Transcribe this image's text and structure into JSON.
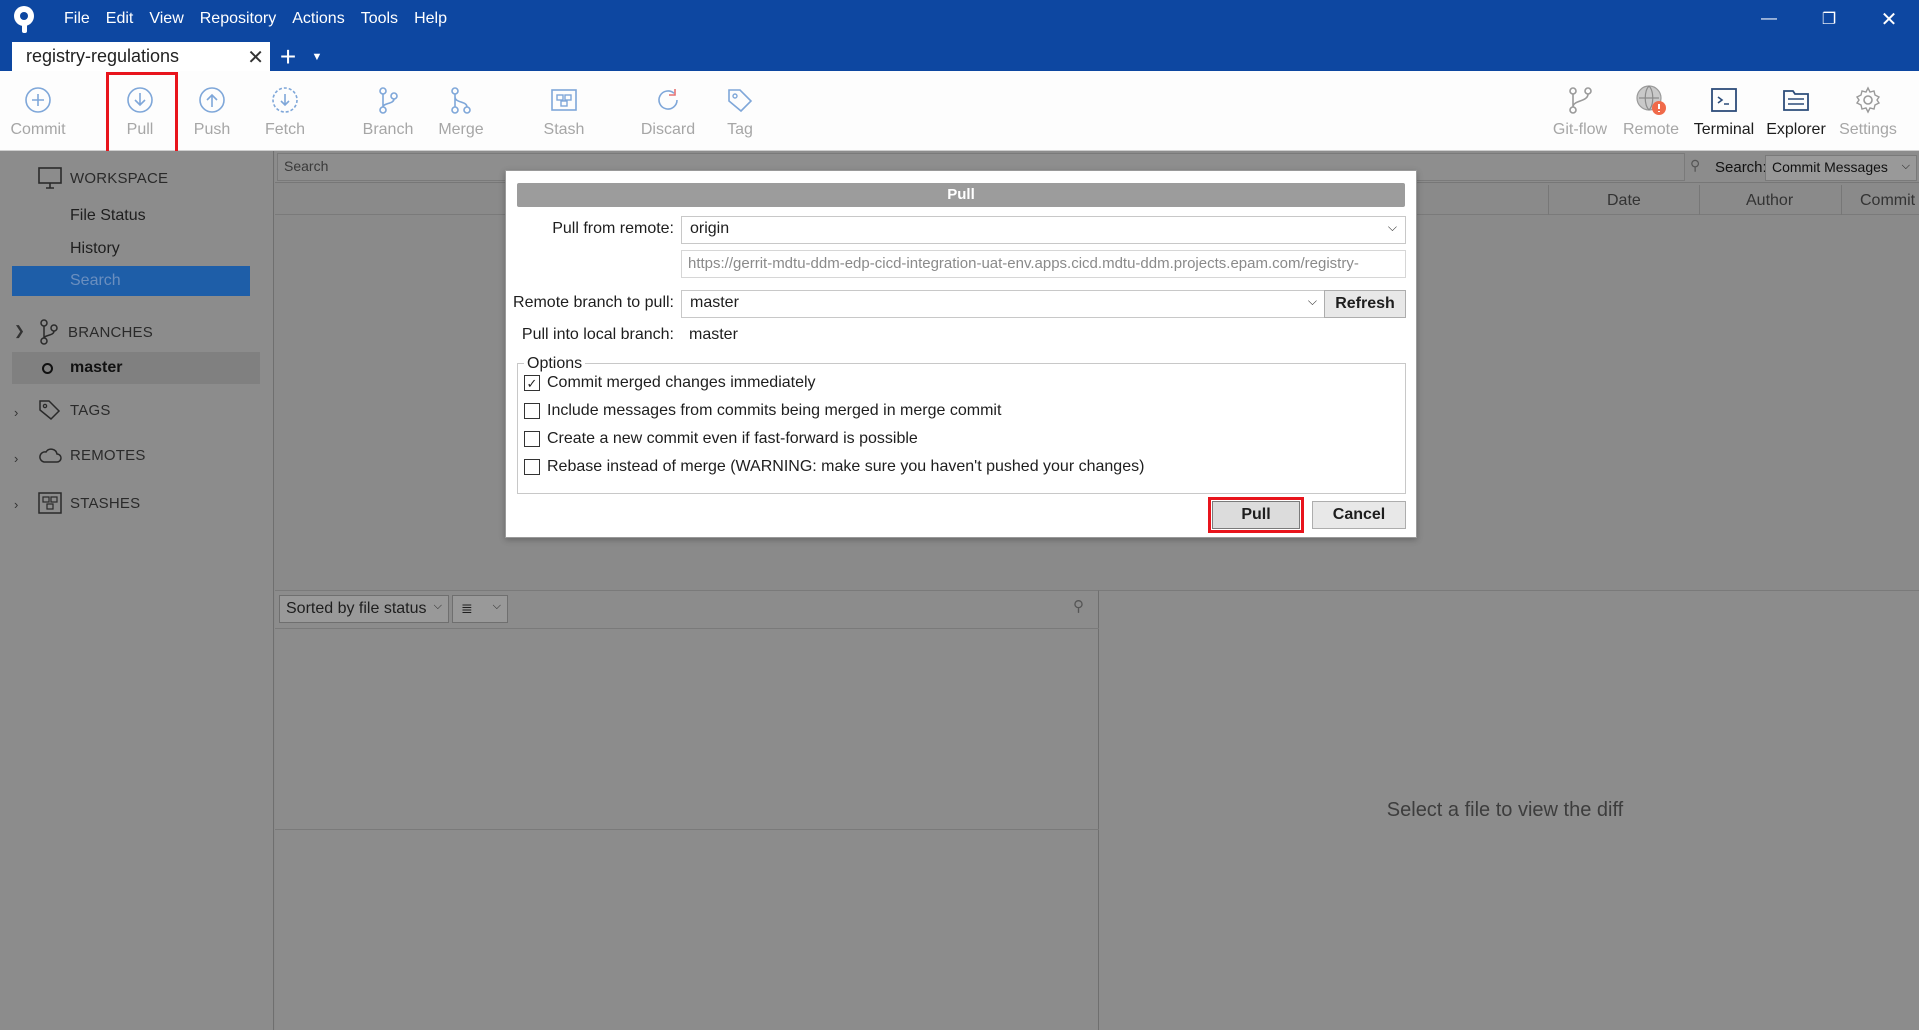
{
  "menu": [
    "File",
    "Edit",
    "View",
    "Repository",
    "Actions",
    "Tools",
    "Help"
  ],
  "tab": {
    "title": "registry-regulations"
  },
  "toolbar": {
    "commit": "Commit",
    "pull": "Pull",
    "push": "Push",
    "fetch": "Fetch",
    "branch": "Branch",
    "merge": "Merge",
    "stash": "Stash",
    "discard": "Discard",
    "tag": "Tag",
    "gitflow": "Git-flow",
    "remote": "Remote",
    "terminal": "Terminal",
    "explorer": "Explorer",
    "settings": "Settings"
  },
  "sidebar": {
    "workspace": "WORKSPACE",
    "file_status": "File Status",
    "history": "History",
    "search": "Search",
    "branches": "BRANCHES",
    "current_branch": "master",
    "tags": "TAGS",
    "remotes": "REMOTES",
    "stashes": "STASHES"
  },
  "search": {
    "placeholder": "Search",
    "label": "Search:",
    "mode": "Commit Messages"
  },
  "columns": {
    "date": "Date",
    "author": "Author",
    "commit": "Commit"
  },
  "files": {
    "sort": "Sorted by file status",
    "view_icon": "≣"
  },
  "diff": {
    "empty_message": "Select a file to view the diff"
  },
  "dialog": {
    "title": "Pull",
    "remote_label": "Pull from remote:",
    "remote_value": "origin",
    "remote_url": "https://gerrit-mdtu-ddm-edp-cicd-integration-uat-env.apps.cicd.mdtu-ddm.projects.epam.com/registry-",
    "branch_label": "Remote branch to pull:",
    "branch_value": "master",
    "refresh": "Refresh",
    "local_label": "Pull into local branch:",
    "local_value": "master",
    "options_legend": "Options",
    "options": [
      {
        "label": "Commit merged changes immediately",
        "checked": true
      },
      {
        "label": "Include messages from commits being merged in merge commit",
        "checked": false
      },
      {
        "label": "Create a new commit even if fast-forward is possible",
        "checked": false
      },
      {
        "label": "Rebase instead of merge (WARNING: make sure you haven't pushed your changes)",
        "checked": false
      }
    ],
    "pull_button": "Pull",
    "cancel_button": "Cancel"
  },
  "colors": {
    "titlebar": "#0d47a1",
    "highlight": "#e8141c",
    "selection": "#1e5ea8"
  }
}
